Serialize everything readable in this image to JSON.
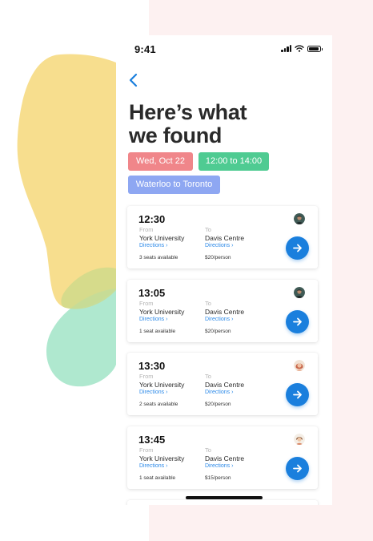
{
  "status_bar": {
    "time": "9:41"
  },
  "header": {
    "title_line1": "Here’s what",
    "title_line2": "we found"
  },
  "filters": {
    "date": "Wed, Oct 22",
    "time_range": "12:00 to 14:00",
    "route": "Waterloo to Toronto"
  },
  "colors": {
    "accent_blue": "#1a7fdd",
    "date_tag": "#f0868a",
    "time_tag": "#4fcb92",
    "route_tag": "#8ea7f2",
    "blob_yellow": "#f6d87a",
    "blob_green": "#a6e5ca",
    "background_pink": "#fdf1f1"
  },
  "rides": [
    {
      "time": "12:30",
      "from_label": "From",
      "from": "York University",
      "from_directions": "Directions ›",
      "to_label": "To",
      "to": "Davis Centre",
      "to_directions": "Directions ›",
      "seats": "3 seats available",
      "price": "$20/person",
      "driver_icon": "avatar-male-dark"
    },
    {
      "time": "13:05",
      "from_label": "From",
      "from": "York University",
      "from_directions": "Directions ›",
      "to_label": "To",
      "to": "Davis Centre",
      "to_directions": "Directions ›",
      "seats": "1 seat available",
      "price": "$20/person",
      "driver_icon": "avatar-male-dark"
    },
    {
      "time": "13:30",
      "from_label": "From",
      "from": "York University",
      "from_directions": "Directions ›",
      "to_label": "To",
      "to": "Davis Centre",
      "to_directions": "Directions ›",
      "seats": "2 seats available",
      "price": "$20/person",
      "driver_icon": "avatar-female-red-hair"
    },
    {
      "time": "13:45",
      "from_label": "From",
      "from": "York University",
      "from_directions": "Directions ›",
      "to_label": "To",
      "to": "Davis Centre",
      "to_directions": "Directions ›",
      "seats": "1 seat available",
      "price": "$15/person",
      "driver_icon": "avatar-female-light"
    }
  ]
}
